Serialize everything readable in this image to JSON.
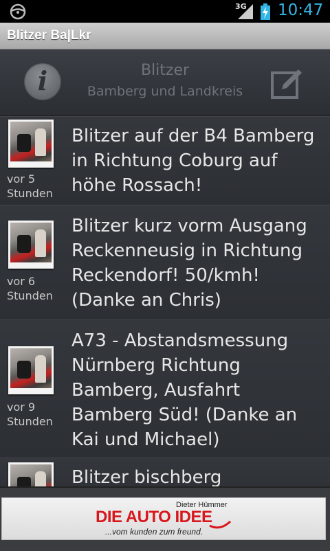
{
  "status_bar": {
    "network": "3G",
    "time": "10:47",
    "icons": [
      "steering-wheel-icon",
      "signal-icon",
      "battery-charging-icon"
    ]
  },
  "app": {
    "title": "Blitzer Ba|Lkr"
  },
  "header": {
    "title": "Blitzer",
    "subtitle": "Bamberg und Landkreis",
    "info_icon": "info-icon",
    "edit_icon": "compose-icon"
  },
  "feed": [
    {
      "age": "vor 5\nStunden",
      "text": "Blitzer auf der B4 Bamberg in Richtung Coburg auf höhe Rossach!"
    },
    {
      "age": "vor 6\nStunden",
      "text": "Blitzer kurz vorm Ausgang Reckenneusig in Richtung Reckendorf! 50/kmh! (Danke an Chris)"
    },
    {
      "age": "vor 9\nStunden",
      "text": "A73 - Abstandsmessung Nürnberg Richtung Bamberg, Ausfahrt Bamberg Süd! (Danke an Kai und Michael)"
    },
    {
      "age": "",
      "text": "Blitzer bischberg"
    }
  ],
  "ad": {
    "owner": "Dieter Hümmer",
    "brand": "DIE AUTO IDEE",
    "slogan": "...vom kunden zum freund."
  },
  "colors": {
    "status_accent": "#33b5e5",
    "ad_red": "#d8171c"
  }
}
